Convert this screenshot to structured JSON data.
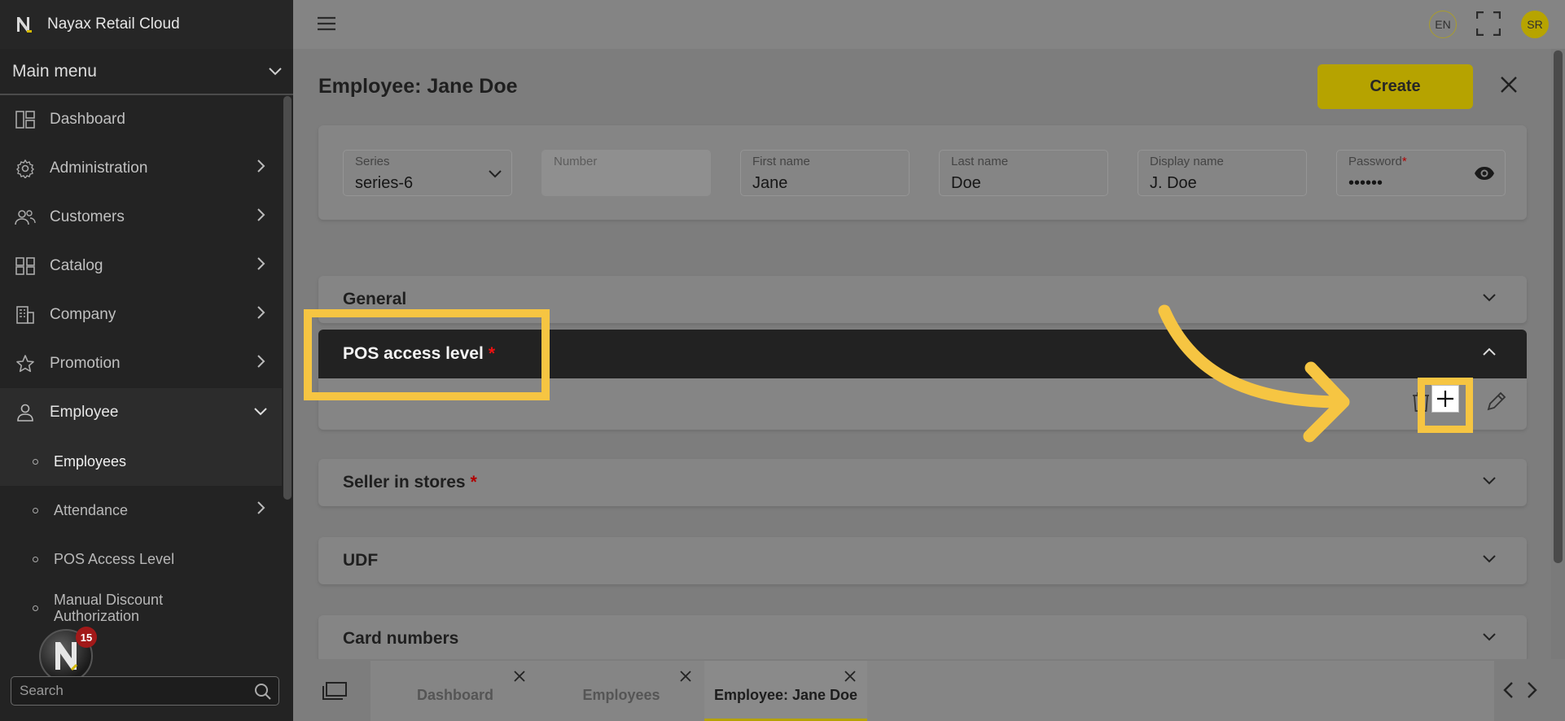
{
  "app": {
    "title": "Nayax Retail Cloud"
  },
  "sidebar": {
    "main_menu_label": "Main menu",
    "items": [
      {
        "label": "Dashboard",
        "icon": "dashboard-icon"
      },
      {
        "label": "Administration",
        "icon": "gear-icon"
      },
      {
        "label": "Customers",
        "icon": "users-icon"
      },
      {
        "label": "Catalog",
        "icon": "grid-icon"
      },
      {
        "label": "Company",
        "icon": "building-icon"
      },
      {
        "label": "Promotion",
        "icon": "star-icon"
      },
      {
        "label": "Employee",
        "icon": "person-icon"
      }
    ],
    "employee_sub": [
      {
        "label": "Employees"
      },
      {
        "label": "Attendance"
      },
      {
        "label": "POS Access Level"
      },
      {
        "label": "Manual Discount Authorization"
      }
    ],
    "search_placeholder": "Search",
    "notification_count": "15"
  },
  "topbar": {
    "lang": "EN",
    "avatar": "SR"
  },
  "page": {
    "title": "Employee: Jane Doe",
    "create_label": "Create"
  },
  "fields": {
    "series": {
      "label": "Series",
      "value": "series-6"
    },
    "number": {
      "label": "Number",
      "value": ""
    },
    "first_name": {
      "label": "First name",
      "value": "Jane"
    },
    "last_name": {
      "label": "Last name",
      "value": "Doe"
    },
    "display_name": {
      "label": "Display name",
      "value": "J. Doe"
    },
    "password": {
      "label": "Password",
      "required_mark": "*",
      "value": "••••••"
    }
  },
  "sections": {
    "general": "General",
    "pos_access": "POS access level",
    "seller": "Seller in stores",
    "udf": "UDF",
    "card_numbers": "Card numbers",
    "required_mark": "*"
  },
  "tabs": [
    {
      "label": "Dashboard"
    },
    {
      "label": "Employees"
    },
    {
      "label": "Employee: Jane Doe"
    }
  ],
  "colors": {
    "accent": "#b6a300",
    "highlight": "#f6c542",
    "sidebar_bg": "#232323"
  }
}
